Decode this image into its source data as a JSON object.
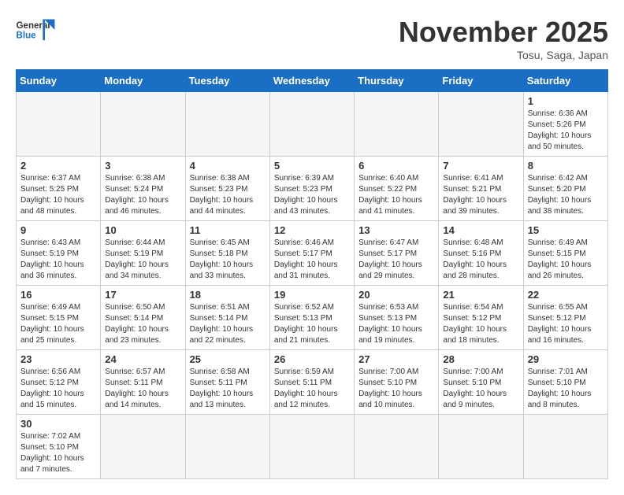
{
  "header": {
    "logo_general": "General",
    "logo_blue": "Blue",
    "month_title": "November 2025",
    "subtitle": "Tosu, Saga, Japan"
  },
  "days_of_week": [
    "Sunday",
    "Monday",
    "Tuesday",
    "Wednesday",
    "Thursday",
    "Friday",
    "Saturday"
  ],
  "weeks": [
    [
      {
        "day": "",
        "info": ""
      },
      {
        "day": "",
        "info": ""
      },
      {
        "day": "",
        "info": ""
      },
      {
        "day": "",
        "info": ""
      },
      {
        "day": "",
        "info": ""
      },
      {
        "day": "",
        "info": ""
      },
      {
        "day": "1",
        "info": "Sunrise: 6:36 AM\nSunset: 5:26 PM\nDaylight: 10 hours and 50 minutes."
      }
    ],
    [
      {
        "day": "2",
        "info": "Sunrise: 6:37 AM\nSunset: 5:25 PM\nDaylight: 10 hours and 48 minutes."
      },
      {
        "day": "3",
        "info": "Sunrise: 6:38 AM\nSunset: 5:24 PM\nDaylight: 10 hours and 46 minutes."
      },
      {
        "day": "4",
        "info": "Sunrise: 6:38 AM\nSunset: 5:23 PM\nDaylight: 10 hours and 44 minutes."
      },
      {
        "day": "5",
        "info": "Sunrise: 6:39 AM\nSunset: 5:23 PM\nDaylight: 10 hours and 43 minutes."
      },
      {
        "day": "6",
        "info": "Sunrise: 6:40 AM\nSunset: 5:22 PM\nDaylight: 10 hours and 41 minutes."
      },
      {
        "day": "7",
        "info": "Sunrise: 6:41 AM\nSunset: 5:21 PM\nDaylight: 10 hours and 39 minutes."
      },
      {
        "day": "8",
        "info": "Sunrise: 6:42 AM\nSunset: 5:20 PM\nDaylight: 10 hours and 38 minutes."
      }
    ],
    [
      {
        "day": "9",
        "info": "Sunrise: 6:43 AM\nSunset: 5:19 PM\nDaylight: 10 hours and 36 minutes."
      },
      {
        "day": "10",
        "info": "Sunrise: 6:44 AM\nSunset: 5:19 PM\nDaylight: 10 hours and 34 minutes."
      },
      {
        "day": "11",
        "info": "Sunrise: 6:45 AM\nSunset: 5:18 PM\nDaylight: 10 hours and 33 minutes."
      },
      {
        "day": "12",
        "info": "Sunrise: 6:46 AM\nSunset: 5:17 PM\nDaylight: 10 hours and 31 minutes."
      },
      {
        "day": "13",
        "info": "Sunrise: 6:47 AM\nSunset: 5:17 PM\nDaylight: 10 hours and 29 minutes."
      },
      {
        "day": "14",
        "info": "Sunrise: 6:48 AM\nSunset: 5:16 PM\nDaylight: 10 hours and 28 minutes."
      },
      {
        "day": "15",
        "info": "Sunrise: 6:49 AM\nSunset: 5:15 PM\nDaylight: 10 hours and 26 minutes."
      }
    ],
    [
      {
        "day": "16",
        "info": "Sunrise: 6:49 AM\nSunset: 5:15 PM\nDaylight: 10 hours and 25 minutes."
      },
      {
        "day": "17",
        "info": "Sunrise: 6:50 AM\nSunset: 5:14 PM\nDaylight: 10 hours and 23 minutes."
      },
      {
        "day": "18",
        "info": "Sunrise: 6:51 AM\nSunset: 5:14 PM\nDaylight: 10 hours and 22 minutes."
      },
      {
        "day": "19",
        "info": "Sunrise: 6:52 AM\nSunset: 5:13 PM\nDaylight: 10 hours and 21 minutes."
      },
      {
        "day": "20",
        "info": "Sunrise: 6:53 AM\nSunset: 5:13 PM\nDaylight: 10 hours and 19 minutes."
      },
      {
        "day": "21",
        "info": "Sunrise: 6:54 AM\nSunset: 5:12 PM\nDaylight: 10 hours and 18 minutes."
      },
      {
        "day": "22",
        "info": "Sunrise: 6:55 AM\nSunset: 5:12 PM\nDaylight: 10 hours and 16 minutes."
      }
    ],
    [
      {
        "day": "23",
        "info": "Sunrise: 6:56 AM\nSunset: 5:12 PM\nDaylight: 10 hours and 15 minutes."
      },
      {
        "day": "24",
        "info": "Sunrise: 6:57 AM\nSunset: 5:11 PM\nDaylight: 10 hours and 14 minutes."
      },
      {
        "day": "25",
        "info": "Sunrise: 6:58 AM\nSunset: 5:11 PM\nDaylight: 10 hours and 13 minutes."
      },
      {
        "day": "26",
        "info": "Sunrise: 6:59 AM\nSunset: 5:11 PM\nDaylight: 10 hours and 12 minutes."
      },
      {
        "day": "27",
        "info": "Sunrise: 7:00 AM\nSunset: 5:10 PM\nDaylight: 10 hours and 10 minutes."
      },
      {
        "day": "28",
        "info": "Sunrise: 7:00 AM\nSunset: 5:10 PM\nDaylight: 10 hours and 9 minutes."
      },
      {
        "day": "29",
        "info": "Sunrise: 7:01 AM\nSunset: 5:10 PM\nDaylight: 10 hours and 8 minutes."
      }
    ],
    [
      {
        "day": "30",
        "info": "Sunrise: 7:02 AM\nSunset: 5:10 PM\nDaylight: 10 hours and 7 minutes."
      },
      {
        "day": "",
        "info": ""
      },
      {
        "day": "",
        "info": ""
      },
      {
        "day": "",
        "info": ""
      },
      {
        "day": "",
        "info": ""
      },
      {
        "day": "",
        "info": ""
      },
      {
        "day": "",
        "info": ""
      }
    ]
  ]
}
